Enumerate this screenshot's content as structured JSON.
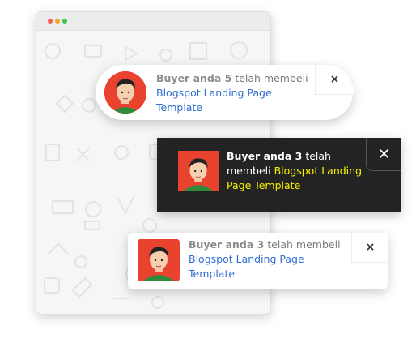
{
  "colors": {
    "avatar_bg": "#e94330",
    "product_link": "#2f6fd0",
    "dark_toast_bg": "#232323",
    "dark_product_link": "#f8f200"
  },
  "toasts": [
    {
      "buyer": "Buyer anda 5",
      "action": " telah membeli ",
      "product": "Blogspot Landing Page Template",
      "close_icon": "×",
      "avatar_icon": "person-avatar-icon"
    },
    {
      "buyer": "Buyer anda 3",
      "action": " telah membeli ",
      "product": "Blogspot Landing Page Template",
      "close_icon": "✕",
      "avatar_icon": "person-avatar-icon"
    },
    {
      "buyer": "Buyer anda 3",
      "action": " telah membeli ",
      "product": "Blogspot Landing Page Template",
      "close_icon": "×",
      "avatar_icon": "person-avatar-icon"
    }
  ]
}
